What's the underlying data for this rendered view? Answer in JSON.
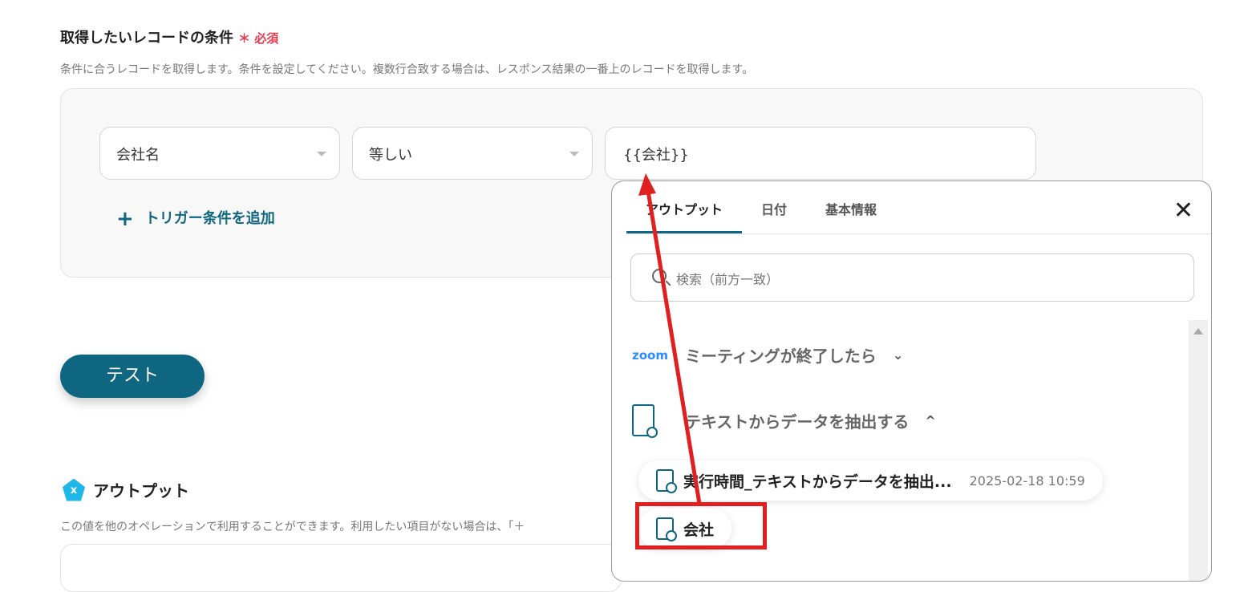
{
  "section": {
    "title": "取得したいレコードの条件",
    "required_mark": "＊",
    "required_label": "必須",
    "description": "条件に合うレコードを取得します。条件を設定してください。複数行合致する場合は、レスポンス結果の一番上のレコードを取得します。"
  },
  "condition": {
    "field": "会社名",
    "operator": "等しい",
    "value": "{{会社}}",
    "add_label": "トリガー条件を追加"
  },
  "test_button": "テスト",
  "output": {
    "title": "アウトプット",
    "icon_letter": "x",
    "description": "この値を他のオペレーションで利用することができます。利用したい項目がない場合は、「＋"
  },
  "popup": {
    "tabs": [
      "アウトプット",
      "日付",
      "基本情報"
    ],
    "search_placeholder": "検索（前方一致）",
    "groups": [
      {
        "logo": "zoom",
        "label": "ミーティングが終了したら",
        "chevron": "⌄"
      },
      {
        "label": "テキストからデータを抽出する",
        "chevron": "^"
      }
    ],
    "items": [
      {
        "label": "実行時間_テキストからデータを抽出...",
        "date": "2025-02-18 10:59"
      },
      {
        "label": "会社"
      }
    ]
  },
  "annotation_color": "#e02020"
}
